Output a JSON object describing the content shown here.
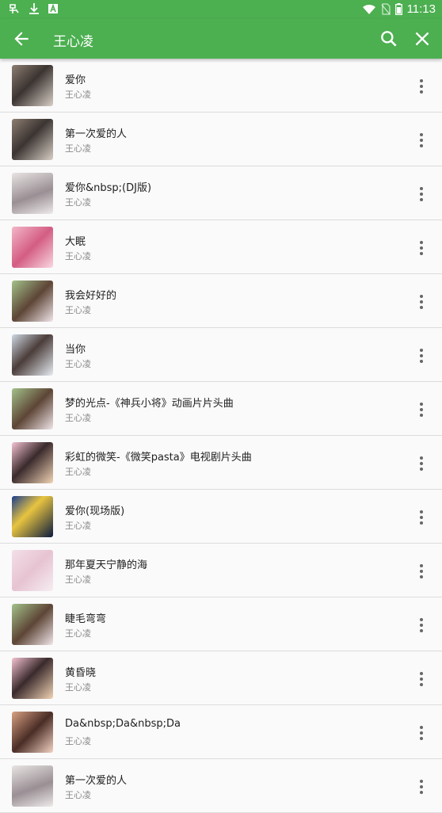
{
  "status_bar": {
    "time": "11:13",
    "icons": [
      "app-notification-icon",
      "download-icon",
      "text-a-icon",
      "wifi-icon",
      "no-sim-icon",
      "battery-icon"
    ]
  },
  "app_bar": {
    "title": "王心凌",
    "back_icon": "arrow-left-icon",
    "search_icon": "search-icon",
    "close_icon": "close-icon",
    "color": "#4caf50"
  },
  "songs": [
    {
      "title": "爱你",
      "artist": "王心凌",
      "cover": "art-1"
    },
    {
      "title": "第一次爱的人",
      "artist": "王心凌",
      "cover": "art-1"
    },
    {
      "title": "爱你&nbsp;(DJ版)",
      "artist": "王心凌",
      "cover": "art-2"
    },
    {
      "title": "大眠",
      "artist": "王心凌",
      "cover": "art-3"
    },
    {
      "title": "我会好好的",
      "artist": "王心凌",
      "cover": "art-4"
    },
    {
      "title": "当你",
      "artist": "王心凌",
      "cover": "art-5"
    },
    {
      "title": "梦的光点-《神兵小将》动画片片头曲",
      "artist": "王心凌",
      "cover": "art-4"
    },
    {
      "title": "彩虹的微笑-《微笑pasta》电视剧片头曲",
      "artist": "王心凌",
      "cover": "art-6"
    },
    {
      "title": "爱你(现场版)",
      "artist": "王心凌",
      "cover": "art-7"
    },
    {
      "title": "那年夏天宁静的海",
      "artist": "王心凌",
      "cover": "art-8"
    },
    {
      "title": "睫毛弯弯",
      "artist": "王心凌",
      "cover": "art-4"
    },
    {
      "title": "黄昏晓",
      "artist": "王心凌",
      "cover": "art-6"
    },
    {
      "title": "Da&nbsp;Da&nbsp;Da",
      "artist": "王心凌",
      "cover": "art-9"
    },
    {
      "title": "第一次爱的人",
      "artist": "王心凌",
      "cover": "art-2"
    }
  ],
  "more_icon": "more-vertical-icon"
}
